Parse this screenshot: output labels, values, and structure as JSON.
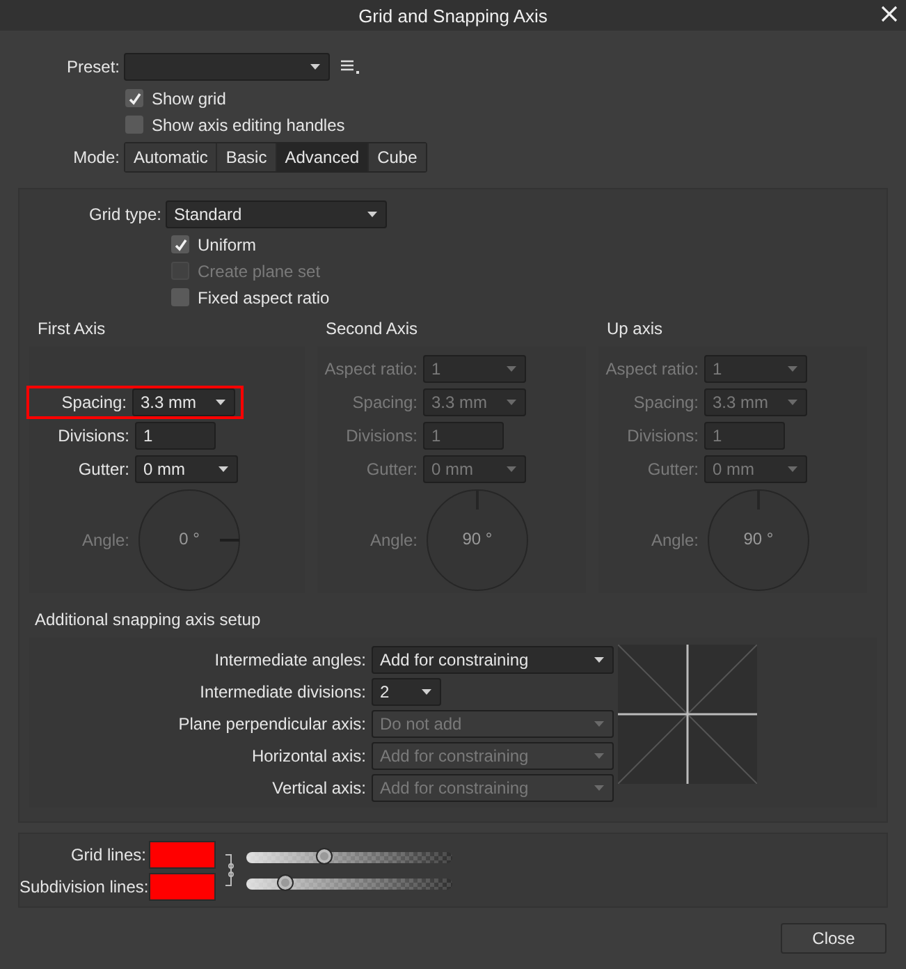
{
  "window": {
    "title": "Grid and Snapping Axis"
  },
  "preset": {
    "label": "Preset:"
  },
  "options": [
    {
      "label": "Show grid",
      "checked": true
    },
    {
      "label": "Show axis editing handles",
      "checked": false
    }
  ],
  "mode": {
    "label": "Mode:",
    "options": [
      {
        "label": "Automatic",
        "selected": false
      },
      {
        "label": "Basic",
        "selected": false
      },
      {
        "label": "Advanced",
        "selected": true
      },
      {
        "label": "Cube",
        "selected": false
      }
    ]
  },
  "grid_type": {
    "label": "Grid type:",
    "value": "Standard"
  },
  "grid_options": [
    {
      "label": "Uniform",
      "checked": true,
      "disabled": false
    },
    {
      "label": "Create plane set",
      "checked": false,
      "disabled": true
    },
    {
      "label": "Fixed aspect ratio",
      "checked": false,
      "disabled": false
    }
  ],
  "axes": [
    {
      "title": "First Axis",
      "disabled": false,
      "fields": [
        {
          "kind": "spacer"
        },
        {
          "kind": "dropdown",
          "label": "Spacing:",
          "value": "3.3 mm",
          "highlighted": true
        },
        {
          "kind": "input",
          "label": "Divisions:",
          "value": "1",
          "highlighted": false
        },
        {
          "kind": "dropdown",
          "label": "Gutter:",
          "value": "0 mm",
          "highlighted": false
        }
      ],
      "angle": {
        "label": "Angle:",
        "value": "0 °",
        "kind": "right"
      }
    },
    {
      "title": "Second Axis",
      "disabled": true,
      "fields": [
        {
          "kind": "dropdown",
          "label": "Aspect ratio:",
          "value": "1",
          "highlighted": false
        },
        {
          "kind": "dropdown",
          "label": "Spacing:",
          "value": "3.3 mm",
          "highlighted": false
        },
        {
          "kind": "input",
          "label": "Divisions:",
          "value": "1",
          "highlighted": false
        },
        {
          "kind": "dropdown",
          "label": "Gutter:",
          "value": "0 mm",
          "highlighted": false
        }
      ],
      "angle": {
        "label": "Angle:",
        "value": "90 °",
        "kind": "top"
      }
    },
    {
      "title": "Up axis",
      "disabled": true,
      "fields": [
        {
          "kind": "dropdown",
          "label": "Aspect ratio:",
          "value": "1",
          "highlighted": false
        },
        {
          "kind": "dropdown",
          "label": "Spacing:",
          "value": "3.3 mm",
          "highlighted": false
        },
        {
          "kind": "input",
          "label": "Divisions:",
          "value": "1",
          "highlighted": false
        },
        {
          "kind": "dropdown",
          "label": "Gutter:",
          "value": "0 mm",
          "highlighted": false
        }
      ],
      "angle": {
        "label": "Angle:",
        "value": "90 °",
        "kind": "top"
      }
    }
  ],
  "snapping": {
    "title": "Additional snapping axis setup",
    "rows": [
      {
        "label": "Intermediate angles:",
        "value": "Add for constraining",
        "kind": "wide",
        "disabled": false
      },
      {
        "label": "Intermediate divisions:",
        "value": "2",
        "kind": "compact",
        "disabled": false
      },
      {
        "label": "Plane perpendicular axis:",
        "value": "Do not add",
        "kind": "wide",
        "disabled": true
      },
      {
        "label": "Horizontal axis:",
        "value": "Add for constraining",
        "kind": "wide",
        "disabled": true
      },
      {
        "label": "Vertical axis:",
        "value": "Add for constraining",
        "kind": "wide",
        "disabled": true
      }
    ]
  },
  "lines": [
    {
      "label": "Grid lines:",
      "color": "#ff0000",
      "level": 0.38
    },
    {
      "label": "Subdivision lines:",
      "color": "#ff0000",
      "level": 0.19
    }
  ],
  "buttons": [
    {
      "label": "Close"
    }
  ]
}
